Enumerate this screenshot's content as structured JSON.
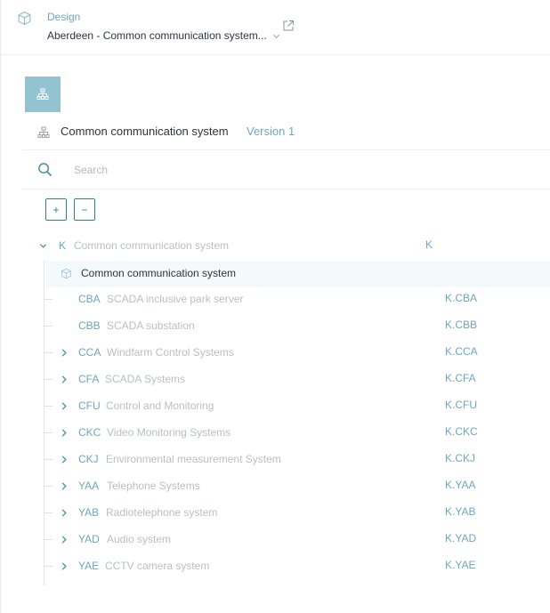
{
  "header": {
    "label": "Design",
    "selected": "Aberdeen - Common communication system...",
    "icons": {
      "cube": "cube-icon",
      "external": "external-link-icon",
      "dropdown": "chevron-down-icon"
    }
  },
  "toolbar": {
    "tile_icon": "hierarchy-icon"
  },
  "title": {
    "text": "Common communication system",
    "version": "Version 1"
  },
  "search": {
    "placeholder": "Search",
    "value": ""
  },
  "controls": {
    "expand_label": "+",
    "collapse_label": "−"
  },
  "tree": {
    "root": {
      "code": "K",
      "name": "Common communication system",
      "ref": "K",
      "expanded": true
    },
    "selected": {
      "name": "Common communication system"
    },
    "items": [
      {
        "code": "CBA",
        "name": "SCADA inclusive park server",
        "ref": "K.CBA",
        "expandable": false
      },
      {
        "code": "CBB",
        "name": "SCADA substation",
        "ref": "K.CBB",
        "expandable": false
      },
      {
        "code": "CCA",
        "name": "Windfarm Control Systems",
        "ref": "K.CCA",
        "expandable": true
      },
      {
        "code": "CFA",
        "name": "SCADA Systems",
        "ref": "K.CFA",
        "expandable": true
      },
      {
        "code": "CFU",
        "name": "Control and Monitoring",
        "ref": "K.CFU",
        "expandable": true
      },
      {
        "code": "CKC",
        "name": "Video Monitoring Systems",
        "ref": "K.CKC",
        "expandable": true
      },
      {
        "code": "CKJ",
        "name": "Environmental measurement System",
        "ref": "K.CKJ",
        "expandable": true
      },
      {
        "code": "YAA",
        "name": "Telephone Systems",
        "ref": "K.YAA",
        "expandable": true
      },
      {
        "code": "YAB",
        "name": "Radiotelephone system",
        "ref": "K.YAB",
        "expandable": true
      },
      {
        "code": "YAD",
        "name": "Audio system",
        "ref": "K.YAD",
        "expandable": true
      },
      {
        "code": "YAE",
        "name": "CCTV camera system",
        "ref": "K.YAE",
        "expandable": true
      }
    ]
  },
  "colors": {
    "accent": "#6ea7bd",
    "tile": "#93c2d0",
    "selected_bg": "#f4f9fb",
    "muted_text": "#b8bfc6"
  }
}
